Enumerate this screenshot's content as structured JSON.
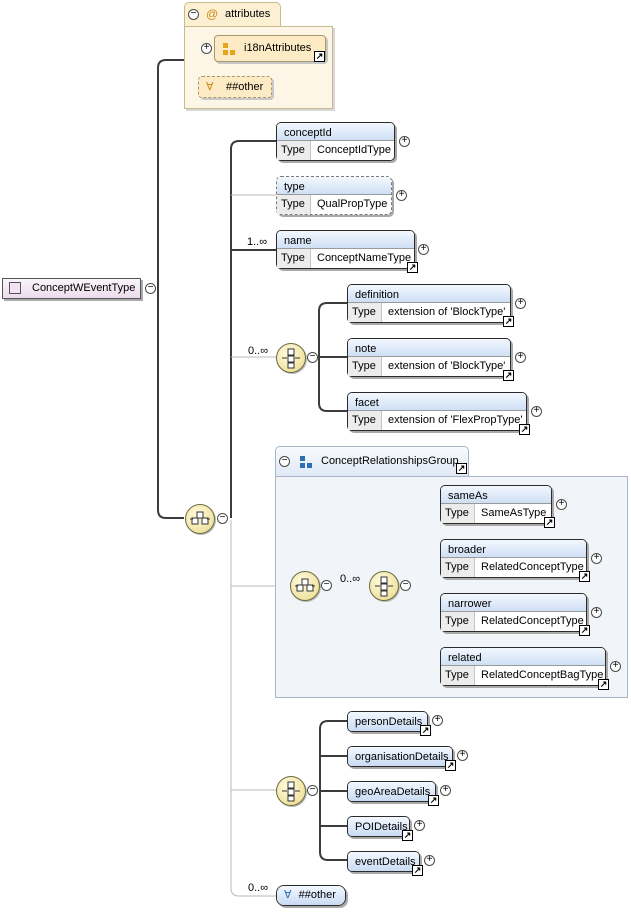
{
  "root": {
    "label": "ConceptWEventType"
  },
  "attributes": {
    "tab_label": "attributes",
    "items": [
      {
        "label": "i18nAttributes",
        "kind": "attribute-group"
      },
      {
        "label": "##other",
        "kind": "any-attribute"
      }
    ]
  },
  "occurrences": {
    "name": "1..∞",
    "notes": "0..∞",
    "group": "0..∞",
    "other": "0..∞"
  },
  "type_key": "Type",
  "elements": {
    "conceptId": {
      "label": "conceptId",
      "type": "ConceptIdType"
    },
    "type": {
      "label": "type",
      "type": "QualPropType"
    },
    "name": {
      "label": "name",
      "type": "ConceptNameType"
    },
    "definition": {
      "label": "definition",
      "type": "extension of 'BlockType'"
    },
    "note": {
      "label": "note",
      "type": "extension of 'BlockType'"
    },
    "facet": {
      "label": "facet",
      "type": "extension of 'FlexPropType'"
    },
    "sameAs": {
      "label": "sameAs",
      "type": "SameAsType"
    },
    "broader": {
      "label": "broader",
      "type": "RelatedConceptType"
    },
    "narrower": {
      "label": "narrower",
      "type": "RelatedConceptType"
    },
    "related": {
      "label": "related",
      "type": "RelatedConceptBagType"
    }
  },
  "group": {
    "label": "ConceptRelationshipsGroup"
  },
  "details": [
    {
      "label": "personDetails"
    },
    {
      "label": "organisationDetails"
    },
    {
      "label": "geoAreaDetails"
    },
    {
      "label": "POIDetails"
    },
    {
      "label": "eventDetails"
    }
  ],
  "any_element": {
    "label": "##other"
  }
}
